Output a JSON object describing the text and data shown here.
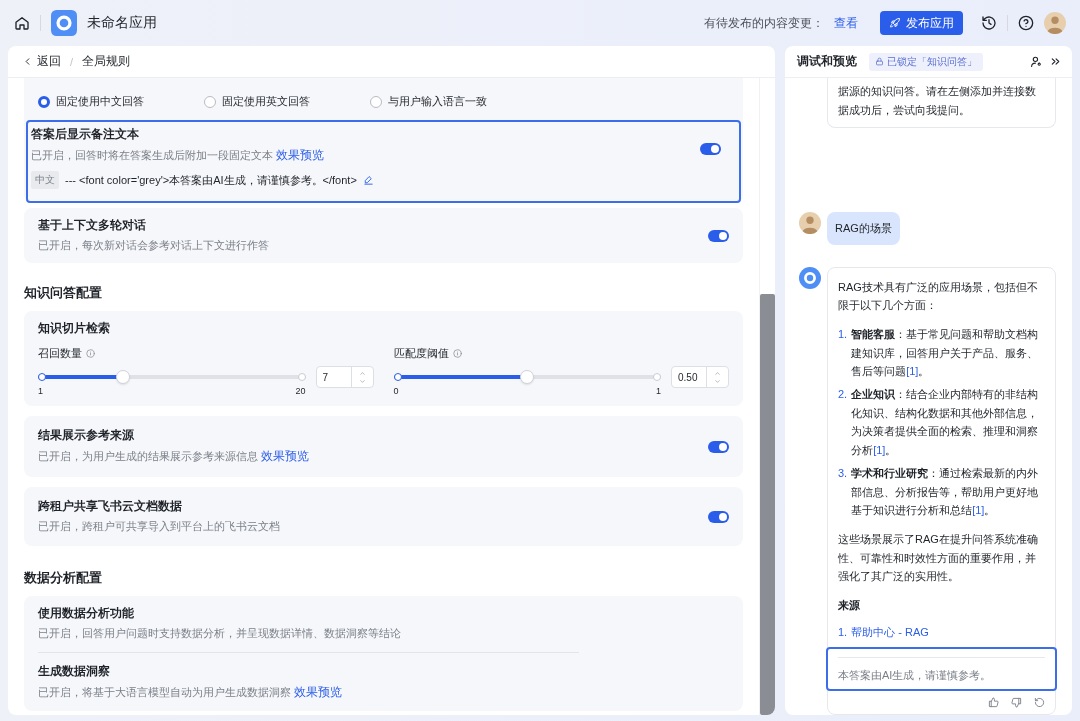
{
  "topbar": {
    "app_name": "未命名应用",
    "pending_label": "有待发布的内容变更：",
    "pending_link": "查看",
    "publish_button": "发布应用"
  },
  "breadcrumb": {
    "back": "返回",
    "separator": "/",
    "current": "全局规则"
  },
  "language_options": [
    {
      "label": "固定使用中文回答",
      "selected": true
    },
    {
      "label": "固定使用英文回答",
      "selected": false
    },
    {
      "label": "与用户输入语言一致",
      "selected": false
    }
  ],
  "answer_note": {
    "title": "答案后显示备注文本",
    "description": "已开启，回答时将在答案生成后附加一段固定文本",
    "link": "效果预览",
    "lang_tag": "中文",
    "note_text": "--- <font color='grey'>本答案由AI生成，请谨慎参考。</font>",
    "on": true,
    "highlighted": true
  },
  "context_card": {
    "title": "基于上下文多轮对话",
    "description": "已开启，每次新对话会参考对话上下文进行作答",
    "on": true
  },
  "knowledge_section": {
    "title": "知识问答配置",
    "retrieval": {
      "title": "知识切片检索",
      "sliders": [
        {
          "label": "召回数量",
          "min": "1",
          "max": "20",
          "value": "7",
          "level": 0.316
        },
        {
          "label": "匹配度阈值",
          "min": "0",
          "max": "1",
          "value": "0.50",
          "level": 0.5
        }
      ]
    },
    "cards": [
      {
        "title": "结果展示参考来源",
        "description": "已开启，为用户生成的结果展示参考来源信息",
        "link": "效果预览",
        "on": true
      },
      {
        "title": "跨租户共享飞书云文档数据",
        "description": "已开启，跨租户可共享导入到平台上的飞书云文档",
        "on": true
      }
    ]
  },
  "data_section": {
    "title": "数据分析配置",
    "items": [
      {
        "title": "使用数据分析功能",
        "description": "已开启，回答用户问题时支持数据分析，并呈现数据详情、数据洞察等结论"
      },
      {
        "title": "生成数据洞察",
        "description": "已开启，将基于大语言模型自动为用户生成数据洞察",
        "link": "效果预览"
      }
    ]
  },
  "preview": {
    "title": "调试和预览",
    "lock_badge": "已锁定「知识问答」",
    "greeting_tail": "据源的知识问答。请在左侧添加并连接数据成功后，尝试向我提问。",
    "user_message": "RAG的场景",
    "answer": {
      "intro": "RAG技术具有广泛的应用场景，包括但不限于以下几个方面：",
      "items": [
        {
          "number": "1.",
          "label": "智能客服",
          "text": "：基于常见问题和帮助文档构建知识库，回答用户关于产品、服务、售后等问题",
          "cite": "[1]",
          "tail": "。"
        },
        {
          "number": "2.",
          "label": "企业知识",
          "text": "：结合企业内部特有的非结构化知识、结构化数据和其他外部信息，为决策者提供全面的检索、推理和洞察分析",
          "cite": "[1]",
          "tail": "。"
        },
        {
          "number": "3.",
          "label": "学术和行业研究",
          "text": "：通过检索最新的内外部信息、分析报告等，帮助用户更好地基于知识进行分析和总结",
          "cite": "[1]",
          "tail": "。"
        }
      ],
      "conclusion": "这些场景展示了RAG在提升问答系统准确性、可靠性和时效性方面的重要作用，并强化了其广泛的实用性。",
      "sources_title": "来源",
      "sources": [
        {
          "number": "1.",
          "title": "帮助中心 - RAG"
        }
      ],
      "note": "本答案由AI生成，请谨慎参考。",
      "note_highlighted": true
    }
  }
}
